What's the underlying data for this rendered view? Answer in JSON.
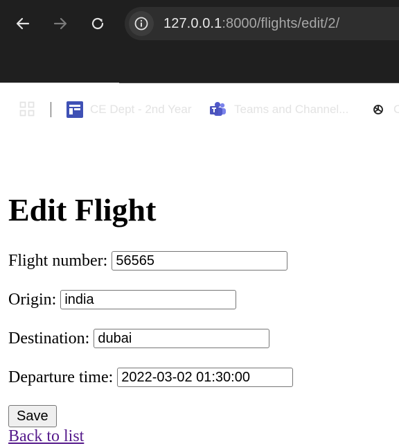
{
  "browser": {
    "url_host": "127.0.0.1",
    "url_rest": ":8000/flights/edit/2/",
    "bookmarks": [
      {
        "label": "CE Dept - 2nd Year",
        "icon": "classroom-icon"
      },
      {
        "label": "Teams and Channel...",
        "icon": "teams-icon"
      },
      {
        "label": "C",
        "icon": "chatgpt-icon"
      }
    ]
  },
  "page": {
    "title": "Edit Flight",
    "fields": [
      {
        "label": "Flight number:",
        "value": "56565"
      },
      {
        "label": "Origin:",
        "value": "india"
      },
      {
        "label": "Destination:",
        "value": "dubai"
      },
      {
        "label": "Departure time:",
        "value": "2022-03-02 01:30:00"
      }
    ],
    "save_label": "Save",
    "back_link": "Back to list"
  },
  "colors": {
    "chrome_bg": "#1f1f1f",
    "omnibox_bg": "#2e2e2e",
    "link_visited": "#551a8b"
  }
}
